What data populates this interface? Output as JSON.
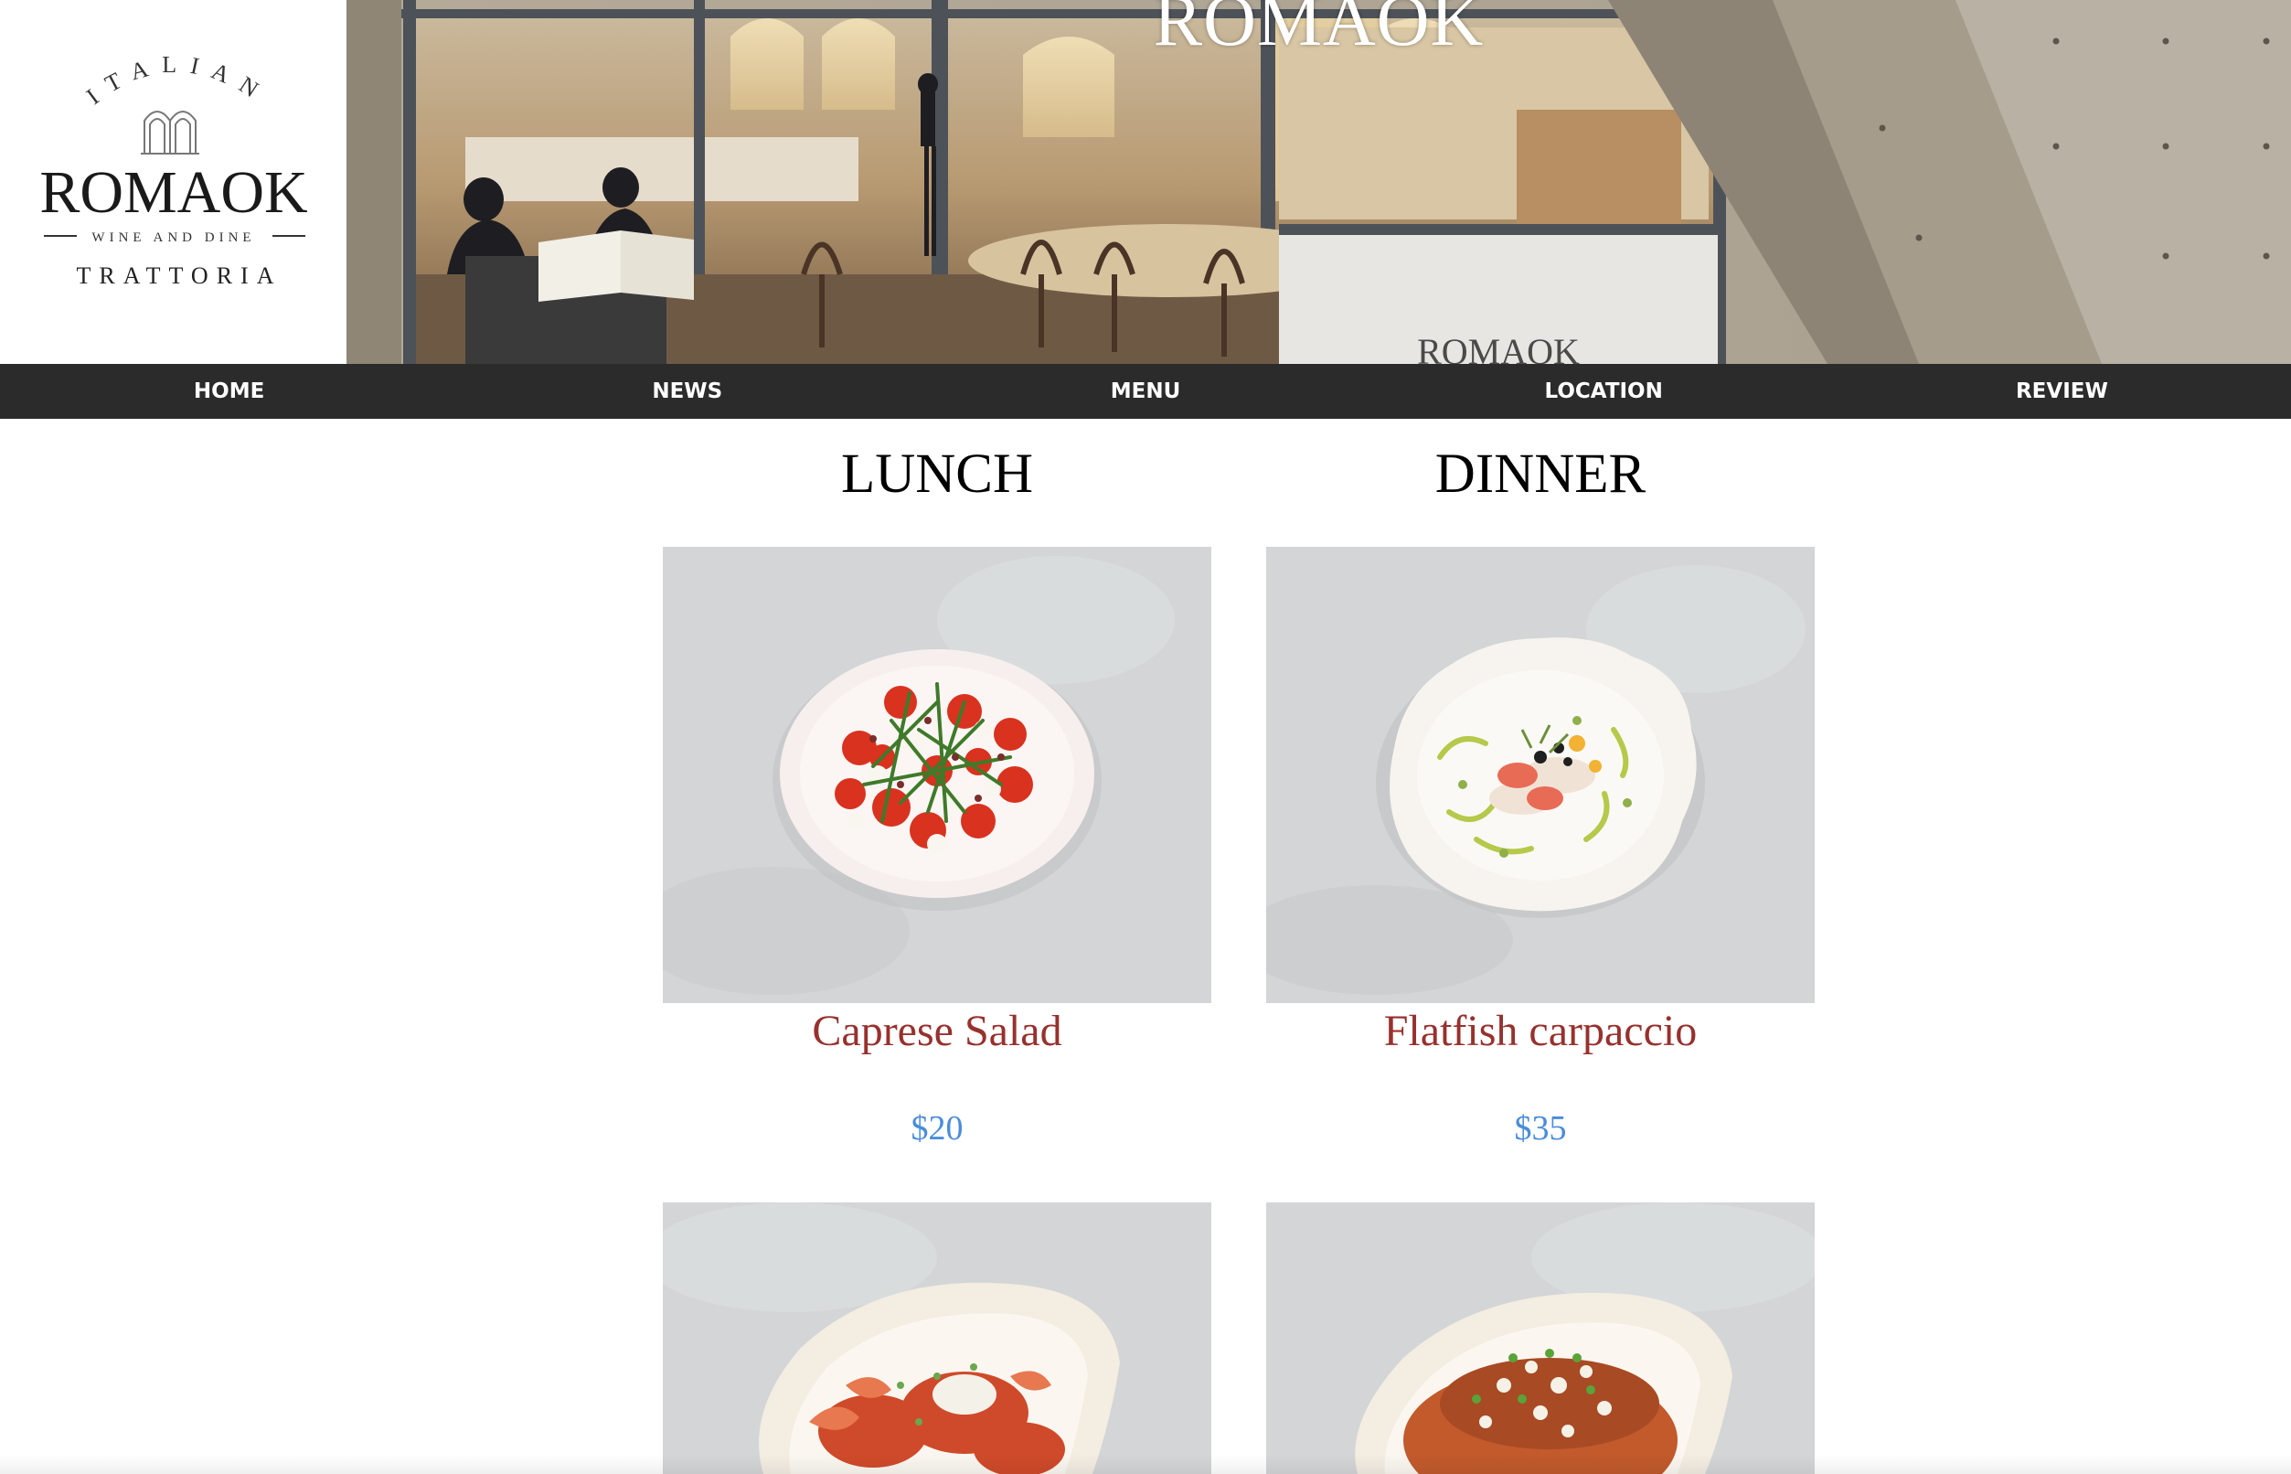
{
  "logo": {
    "top_text": "ITALIAN",
    "brand": "ROMAOK",
    "tagline": "WINE AND DINE",
    "subtitle": "TRATTORIA"
  },
  "hero": {
    "title": "ROMAOK",
    "sign_text": "ROMAOK"
  },
  "nav": {
    "items": [
      {
        "label": "HOME"
      },
      {
        "label": "NEWS"
      },
      {
        "label": "MENU"
      },
      {
        "label": "LOCATION"
      },
      {
        "label": "REVIEW"
      }
    ]
  },
  "menu": {
    "lunch": {
      "heading": "LUNCH",
      "dishes": [
        {
          "name": "Caprese Salad",
          "price": "$20"
        },
        {
          "name": "",
          "price": ""
        }
      ]
    },
    "dinner": {
      "heading": "DINNER",
      "dishes": [
        {
          "name": "Flatfish carpaccio",
          "price": "$35"
        },
        {
          "name": "",
          "price": ""
        }
      ]
    }
  },
  "colors": {
    "nav_bg": "#2b2b2b",
    "dish_name": "#97312e",
    "price": "#4a8ddb",
    "heading": "#000000"
  }
}
